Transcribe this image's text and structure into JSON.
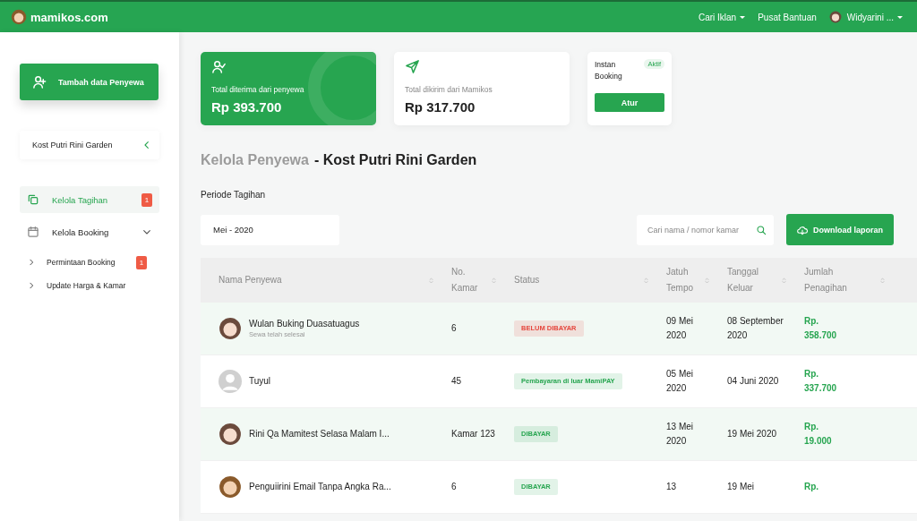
{
  "topbar": {
    "logo": "mamikos.com",
    "menu": [
      {
        "label": "Cari Iklan",
        "dropdown": true
      },
      {
        "label": "Pusat Bantuan",
        "dropdown": false
      }
    ],
    "user": "Widyarini ..."
  },
  "sidebar": {
    "add_button": "Tambah data  Penyewa",
    "property": "Kost Putri Rini Garden",
    "items": [
      {
        "label": "Kelola Tagihan",
        "badge": "1",
        "selected": true
      },
      {
        "label": "Kelola Booking",
        "selected": false,
        "expanded": true,
        "children": [
          {
            "label": "Permintaan  Booking",
            "badge": "1",
            "selected": false
          },
          {
            "label": "Update  Harga & Kamar",
            "selected": false
          }
        ]
      }
    ]
  },
  "cards": [
    {
      "kind": "received",
      "label": "Total diterima dari penyewa",
      "amount": "Rp 393.700"
    },
    {
      "kind": "sent",
      "label": "Total dikirim dari Mamikos",
      "amount": "Rp 317.700"
    }
  ],
  "instant_booking": {
    "title": "Instan Booking",
    "status": "Aktif",
    "button": "Atur"
  },
  "heading": {
    "muted": "Kelola  Penyewa",
    "main": "- Kost Putri Rini Garden"
  },
  "period": {
    "label": "Periode Tagihan",
    "value": "Mei - 2020"
  },
  "search": {
    "placeholder": "Cari nama / nomor kamar"
  },
  "download_button": "Download laporan",
  "table": {
    "columns": [
      "Nama  Penyewa",
      "No. Kamar",
      "Status",
      "Jatuh Tempo",
      "Tanggal Keluar",
      "Jumlah Penagihan"
    ],
    "rows": [
      {
        "kind": "photo",
        "name": "Wulan Buking Duasatuagus",
        "note": "Sewa telah selesai",
        "room": "6",
        "status": "BELUM DIBAYAR",
        "color": "#e5463d",
        "due": "09 Mei 2020",
        "out": "08 September 2020",
        "amount": "Rp. 358.700"
      },
      {
        "kind": "blank",
        "name": "Tuyul",
        "room": "45",
        "status": "Pembayaran di luar MamiPAY",
        "color": "#27a550",
        "due": "05 Mei 2020",
        "out": "04 Juni 2020",
        "amount": "Rp. 337.700"
      },
      {
        "kind": "photo",
        "name": "Rini Qa Mamitest Selasa Malam I...",
        "room": "Kamar 123",
        "status": "DIBAYAR",
        "color": "#27a550",
        "due": "13 Mei 2020",
        "out": "19 Mei 2020",
        "amount": "Rp. 19.000"
      },
      {
        "kind": "photo",
        "name": "Penguiirini Email Tanpa Angka Ra...",
        "room": "6",
        "status": "DIBAYAR",
        "color": "#27a550",
        "due": "13",
        "out": "19 Mei",
        "amount": "Rp."
      }
    ]
  }
}
